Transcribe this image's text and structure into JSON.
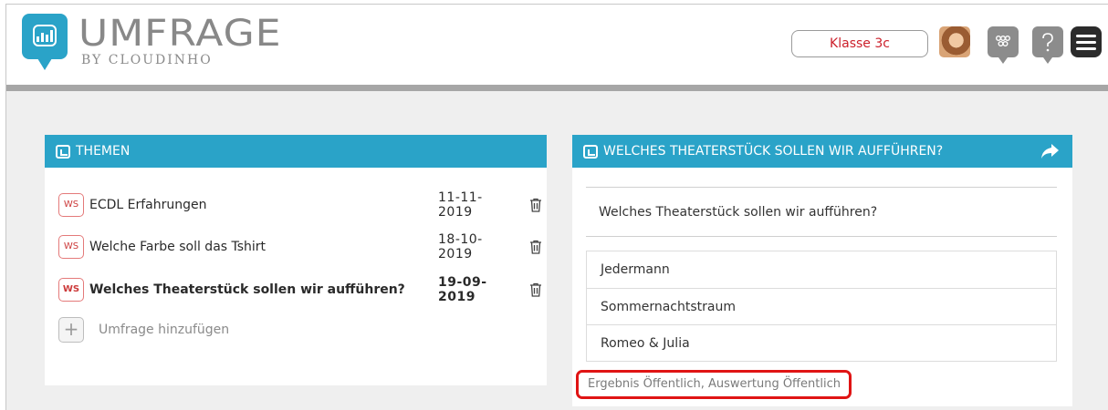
{
  "header": {
    "app_title": "UMFRAGE",
    "app_subtitle": "BY CLOUDINHO",
    "class_selector": "Klasse 3c",
    "icons": [
      "logo-chart-icon",
      "avatar",
      "group-icon",
      "help-icon",
      "menu-icon"
    ]
  },
  "themes_panel": {
    "title": "THEMEN",
    "items": [
      {
        "badge": "WS",
        "title": "ECDL Erfahrungen",
        "date": "11-11-2019",
        "selected": false
      },
      {
        "badge": "WS",
        "title": "Welche Farbe soll das Tshirt",
        "date": "18-10-2019",
        "selected": false
      },
      {
        "badge": "WS",
        "title": "Welches Theaterstück sollen wir aufführen?",
        "date": "19-09-2019",
        "selected": true
      }
    ],
    "add_label": "Umfrage hinzufügen",
    "add_symbol": "+"
  },
  "detail_panel": {
    "title": "WELCHES THEATERSTÜCK SOLLEN WIR AUFFÜHREN?",
    "question": "Welches Theaterstück sollen wir aufführen?",
    "answers": [
      "Jedermann",
      "Sommernachtstraum",
      "Romeo & Julia"
    ],
    "result_note": "Ergebnis Öffentlich, Auswertung Öffentlich"
  },
  "colors": {
    "accent": "#2aa3c8",
    "highlight_red": "#e01414",
    "class_text": "#cc1f2a"
  }
}
